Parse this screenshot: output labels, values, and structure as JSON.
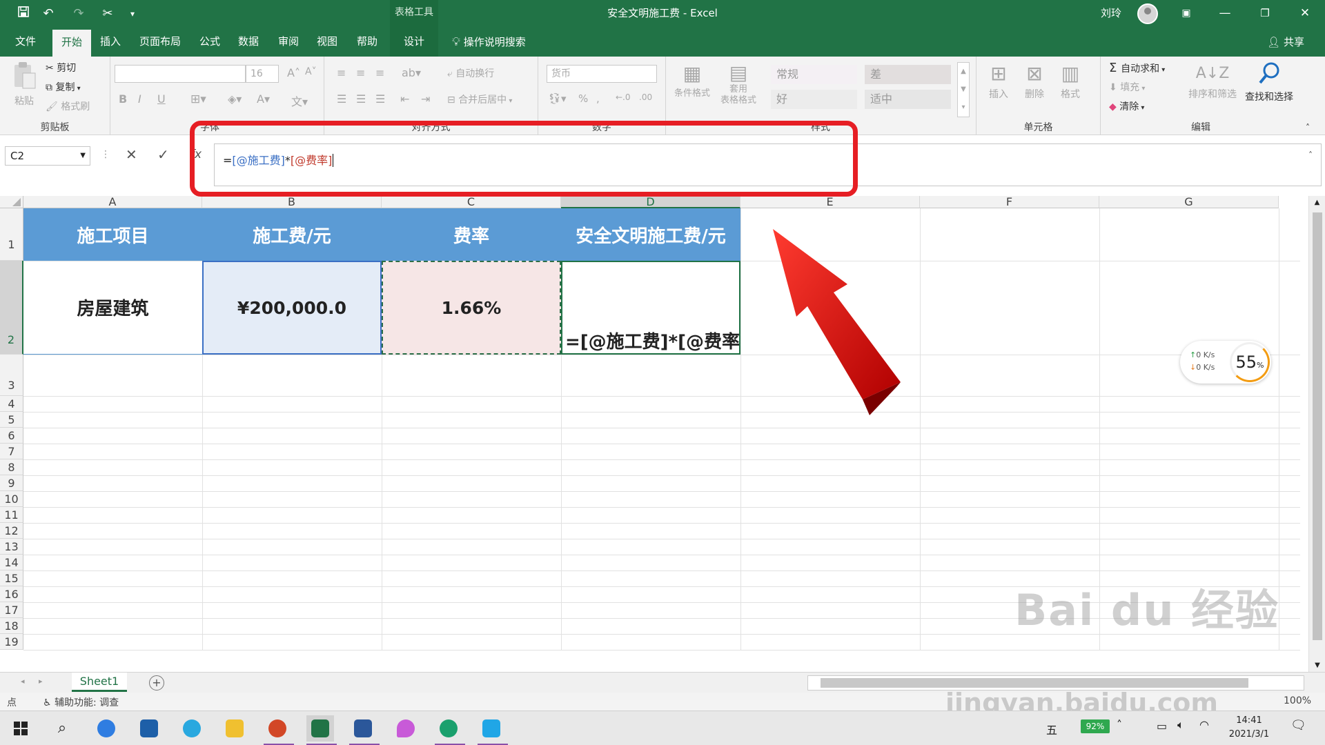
{
  "titlebar": {
    "context_tab": "表格工具",
    "title": "安全文明施工费 - Excel",
    "user": "刘玲",
    "quick_access": [
      "save-icon",
      "undo-icon",
      "redo-icon",
      "cut-icon",
      "customize-icon"
    ]
  },
  "tabs": [
    {
      "label": "文件"
    },
    {
      "label": "开始"
    },
    {
      "label": "插入"
    },
    {
      "label": "页面布局"
    },
    {
      "label": "公式"
    },
    {
      "label": "数据"
    },
    {
      "label": "审阅"
    },
    {
      "label": "视图"
    },
    {
      "label": "帮助"
    },
    {
      "label": "设计"
    }
  ],
  "tell_me": "操作说明搜索",
  "share": "共享",
  "ribbon": {
    "clipboard": {
      "paste": "粘贴",
      "cut": "剪切",
      "copy": "复制",
      "format_painter": "格式刷",
      "label": "剪贴板"
    },
    "font": {
      "name": "",
      "size": "16",
      "label": "字体",
      "bold": "B",
      "italic": "I",
      "underline": "U"
    },
    "alignment": {
      "wrap": "自动换行",
      "merge": "合并后居中",
      "label": "对齐方式"
    },
    "number": {
      "format": "货币",
      "label": "数字"
    },
    "styles": {
      "conditional": "条件格式",
      "table_fmt_1": "套用",
      "table_fmt_2": "表格格式",
      "normal": "常规",
      "bad": "差",
      "good": "好",
      "neutral": "适中",
      "label": "样式"
    },
    "cells": {
      "insert": "插入",
      "delete": "删除",
      "format": "格式",
      "label": "单元格"
    },
    "editing": {
      "autosum": "自动求和",
      "fill": "填充",
      "clear": "清除",
      "sort": "排序和筛选",
      "find": "查找和选择",
      "label": "编辑"
    }
  },
  "formula_bar": {
    "name_box": "C2",
    "formula_prefix": "=",
    "ref1": "[@施工费]",
    "operator": "*",
    "ref2": "[@费率]"
  },
  "columns": [
    "A",
    "B",
    "C",
    "D",
    "E",
    "F",
    "G"
  ],
  "rows": [
    "1",
    "2",
    "3",
    "4",
    "5",
    "6",
    "7",
    "8",
    "9",
    "10",
    "11",
    "12",
    "13",
    "14",
    "15",
    "16",
    "17",
    "18",
    "19"
  ],
  "table": {
    "headers": [
      "施工项目",
      "施工费/元",
      "费率",
      "安全文明施工费/元"
    ],
    "row": [
      "房屋建筑",
      "¥200,000.0",
      "1.66%",
      "=[@施工费]*[@费率]"
    ]
  },
  "net_widget": {
    "up": "0",
    "down": "0",
    "unit": "K/s",
    "cpu": "55",
    "cpu_unit": "%"
  },
  "sheet_tab": "Sheet1",
  "status": {
    "mode": "点",
    "accessibility": "辅助功能: 调查",
    "zoom": "100%"
  },
  "taskbar": {
    "time": "14:41",
    "date": "2021/3/1",
    "battery": "92%",
    "ime": "五"
  },
  "watermark": {
    "brand": "Bai du 经验",
    "url": "jingyan.baidu.com"
  },
  "colors": {
    "excel_green": "#217346",
    "header_blue": "#5b9bd5",
    "highlight_red": "#e61e24",
    "ref1_blue": "#3a6fc4",
    "ref2_red": "#c0392b"
  }
}
